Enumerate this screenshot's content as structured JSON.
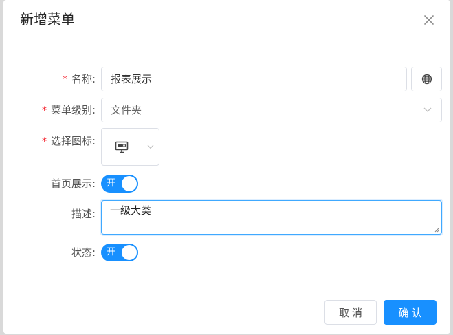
{
  "dialog": {
    "title": "新增菜单",
    "close_icon": "close-icon"
  },
  "form": {
    "name": {
      "label": "名称:",
      "required_mark": "*",
      "value": "报表展示",
      "action_icon": "globe-icon"
    },
    "menu_level": {
      "label": "菜单级别:",
      "required_mark": "*",
      "value": "文件夹",
      "icon": "chevron-down-icon"
    },
    "icon_select": {
      "label": "选择图标:",
      "required_mark": "*",
      "selected_icon": "monitor-icon",
      "arrow_icon": "chevron-down-icon"
    },
    "homepage_display": {
      "label": "首页展示:",
      "switch_text": "开",
      "checked": true
    },
    "description": {
      "label": "描述:",
      "value": "一级大类"
    },
    "status": {
      "label": "状态:",
      "switch_text": "开",
      "checked": true
    }
  },
  "footer": {
    "cancel_label": "取消",
    "ok_label": "确认"
  },
  "colors": {
    "primary": "#1890ff",
    "required": "#f5222d",
    "border": "#dcdfe6"
  }
}
